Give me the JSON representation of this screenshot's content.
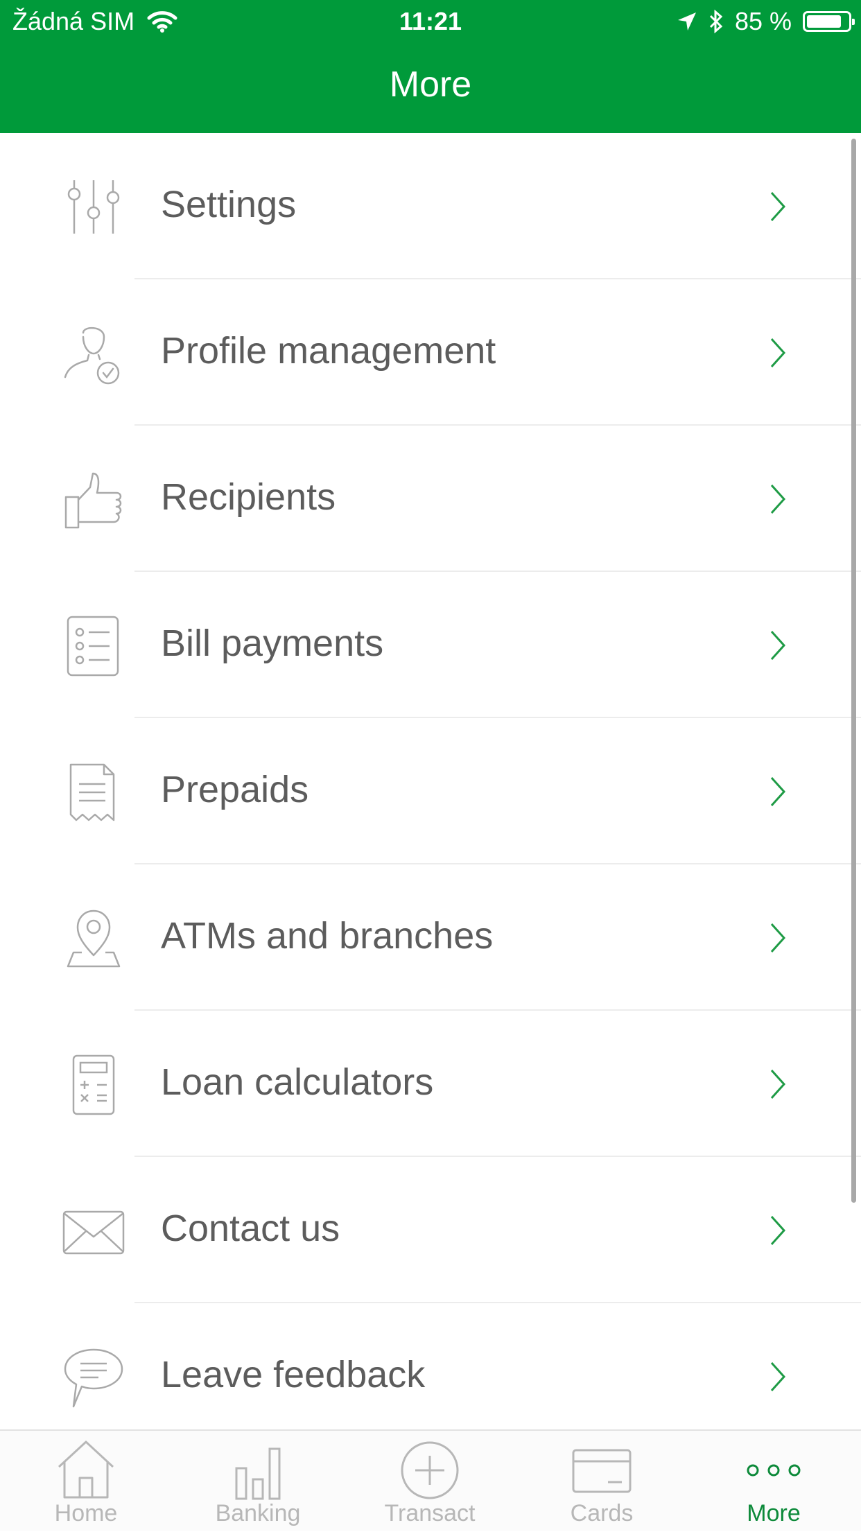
{
  "status_bar": {
    "carrier": "Žádná SIM",
    "time": "11:21",
    "battery_text": "85 %",
    "battery_level": 0.85,
    "icons": [
      "wifi-icon",
      "location-arrow-icon",
      "bluetooth-icon",
      "battery-icon"
    ]
  },
  "header": {
    "title": "More"
  },
  "menu": {
    "items": [
      {
        "label": "Settings",
        "icon": "sliders-icon"
      },
      {
        "label": "Profile management",
        "icon": "user-check-icon"
      },
      {
        "label": "Recipients",
        "icon": "thumbs-up-icon"
      },
      {
        "label": "Bill payments",
        "icon": "checklist-icon"
      },
      {
        "label": "Prepaids",
        "icon": "receipt-icon"
      },
      {
        "label": "ATMs and branches",
        "icon": "map-pin-icon"
      },
      {
        "label": "Loan calculators",
        "icon": "calculator-icon"
      },
      {
        "label": "Contact us",
        "icon": "envelope-icon"
      },
      {
        "label": "Leave feedback",
        "icon": "chat-bubble-icon"
      }
    ]
  },
  "tab_bar": {
    "tabs": [
      {
        "label": "Home",
        "icon": "home-icon",
        "active": false
      },
      {
        "label": "Banking",
        "icon": "bar-chart-icon",
        "active": false
      },
      {
        "label": "Transact",
        "icon": "plus-circle-icon",
        "active": false
      },
      {
        "label": "Cards",
        "icon": "card-icon",
        "active": false
      },
      {
        "label": "More",
        "icon": "more-dots-icon",
        "active": true
      }
    ]
  },
  "colors": {
    "brand_green": "#009a3a",
    "active_tab": "#0d8a3a",
    "chevron": "#1e9b45",
    "label_text": "#5c5c5c",
    "icon_gray": "#a9a9a9",
    "tab_inactive": "#b7b7b7"
  }
}
